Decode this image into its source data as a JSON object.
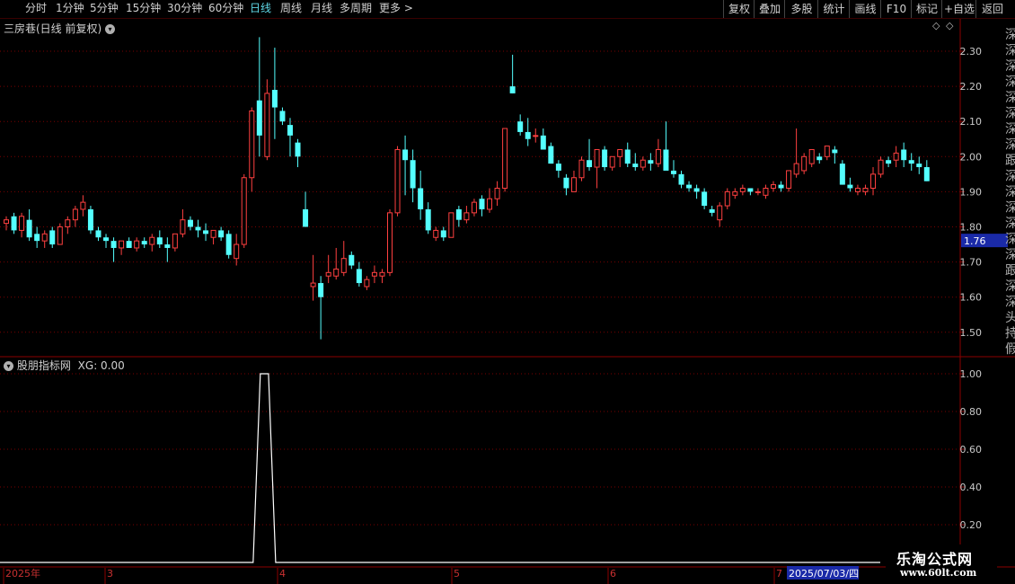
{
  "toolbar": {
    "periods": [
      "分时",
      "1分钟",
      "5分钟",
      "15分钟",
      "30分钟",
      "60分钟",
      "日线",
      "周线",
      "月线",
      "多周期",
      "更多"
    ],
    "active_period": "日线",
    "right_buttons": [
      "复权",
      "叠加",
      "多股",
      "统计",
      "画线",
      "F10",
      "标记",
      "+自选",
      "返回"
    ]
  },
  "price_panel": {
    "title": "三房巷(日线 前复权)",
    "current_price_label": "1.76",
    "y_ticks": [
      "2.30",
      "2.20",
      "2.10",
      "2.00",
      "1.90",
      "1.80",
      "1.70",
      "1.60",
      "1.50"
    ],
    "diamond_icon": "◇",
    "menu_icon": "◇"
  },
  "indicator_panel": {
    "title": "股朋指标网",
    "series_label": "XG: 0.00",
    "y_ticks": [
      "1.00",
      "0.80",
      "0.60",
      "0.40",
      "0.20"
    ]
  },
  "time_axis": {
    "labels": [
      "2025年",
      "3",
      "4",
      "5",
      "6",
      "7"
    ],
    "cursor_date": "2025/07/03/四"
  },
  "watermark": {
    "line1": "乐淘公式网",
    "line2": "www.60lt.com"
  },
  "right_strip_chars": "深深深深深深深深跟深深深深深深跟深深头持假",
  "colors": {
    "up": "#ff4040",
    "down": "#54ffff",
    "axis": "#8b0000",
    "grid": "#7a0000",
    "accent": "#5fd7e6",
    "badge": "#1a2aa8"
  },
  "chart_data": [
    {
      "type": "candlestick",
      "title": "三房巷(日线 前复权)",
      "ylim": [
        1.45,
        2.35
      ],
      "y_ticks": [
        2.3,
        2.2,
        2.1,
        2.0,
        1.9,
        1.8,
        1.7,
        1.6,
        1.5
      ],
      "ohlc": [
        [
          1.81,
          1.83,
          1.79,
          1.82
        ],
        [
          1.83,
          1.84,
          1.78,
          1.79
        ],
        [
          1.79,
          1.84,
          1.77,
          1.83
        ],
        [
          1.82,
          1.85,
          1.76,
          1.77
        ],
        [
          1.78,
          1.8,
          1.74,
          1.76
        ],
        [
          1.76,
          1.79,
          1.74,
          1.78
        ],
        [
          1.79,
          1.8,
          1.74,
          1.75
        ],
        [
          1.75,
          1.81,
          1.75,
          1.8
        ],
        [
          1.8,
          1.83,
          1.78,
          1.82
        ],
        [
          1.82,
          1.86,
          1.8,
          1.85
        ],
        [
          1.85,
          1.89,
          1.83,
          1.87
        ],
        [
          1.85,
          1.86,
          1.78,
          1.79
        ],
        [
          1.79,
          1.8,
          1.76,
          1.77
        ],
        [
          1.77,
          1.78,
          1.74,
          1.76
        ],
        [
          1.76,
          1.77,
          1.7,
          1.74
        ],
        [
          1.74,
          1.76,
          1.72,
          1.76
        ],
        [
          1.76,
          1.77,
          1.74,
          1.74
        ],
        [
          1.74,
          1.77,
          1.73,
          1.76
        ],
        [
          1.76,
          1.77,
          1.74,
          1.75
        ],
        [
          1.75,
          1.78,
          1.73,
          1.77
        ],
        [
          1.77,
          1.79,
          1.74,
          1.75
        ],
        [
          1.75,
          1.77,
          1.7,
          1.74
        ],
        [
          1.74,
          1.78,
          1.73,
          1.78
        ],
        [
          1.78,
          1.85,
          1.77,
          1.82
        ],
        [
          1.82,
          1.83,
          1.79,
          1.8
        ],
        [
          1.8,
          1.82,
          1.77,
          1.79
        ],
        [
          1.79,
          1.81,
          1.76,
          1.78
        ],
        [
          1.77,
          1.79,
          1.75,
          1.79
        ],
        [
          1.79,
          1.8,
          1.76,
          1.77
        ],
        [
          1.78,
          1.79,
          1.71,
          1.72
        ],
        [
          1.71,
          1.78,
          1.69,
          1.75
        ],
        [
          1.75,
          1.95,
          1.74,
          1.94
        ],
        [
          1.94,
          2.14,
          1.9,
          2.13
        ],
        [
          2.16,
          2.34,
          2.0,
          2.06
        ],
        [
          2.0,
          2.22,
          1.99,
          2.18
        ],
        [
          2.19,
          2.31,
          2.05,
          2.14
        ],
        [
          2.13,
          2.14,
          2.09,
          2.1
        ],
        [
          2.09,
          2.11,
          2.0,
          2.06
        ],
        [
          2.04,
          2.05,
          1.97,
          2.0
        ],
        [
          1.85,
          1.9,
          1.8,
          1.8
        ],
        [
          1.63,
          1.72,
          1.59,
          1.64
        ],
        [
          1.64,
          1.66,
          1.48,
          1.6
        ],
        [
          1.66,
          1.72,
          1.64,
          1.67
        ],
        [
          1.66,
          1.74,
          1.65,
          1.68
        ],
        [
          1.67,
          1.76,
          1.66,
          1.71
        ],
        [
          1.72,
          1.73,
          1.68,
          1.69
        ],
        [
          1.68,
          1.7,
          1.63,
          1.64
        ],
        [
          1.63,
          1.66,
          1.62,
          1.65
        ],
        [
          1.66,
          1.69,
          1.64,
          1.67
        ],
        [
          1.66,
          1.68,
          1.64,
          1.67
        ],
        [
          1.67,
          1.85,
          1.66,
          1.84
        ],
        [
          1.84,
          2.03,
          1.83,
          2.02
        ],
        [
          2.02,
          2.06,
          1.89,
          1.99
        ],
        [
          1.99,
          2.02,
          1.87,
          1.91
        ],
        [
          1.91,
          1.96,
          1.82,
          1.85
        ],
        [
          1.85,
          1.87,
          1.78,
          1.79
        ],
        [
          1.77,
          1.8,
          1.76,
          1.79
        ],
        [
          1.79,
          1.8,
          1.76,
          1.77
        ],
        [
          1.77,
          1.84,
          1.77,
          1.84
        ],
        [
          1.85,
          1.86,
          1.8,
          1.82
        ],
        [
          1.82,
          1.86,
          1.81,
          1.84
        ],
        [
          1.84,
          1.88,
          1.83,
          1.87
        ],
        [
          1.88,
          1.89,
          1.83,
          1.85
        ],
        [
          1.85,
          1.91,
          1.84,
          1.88
        ],
        [
          1.88,
          1.93,
          1.86,
          1.91
        ],
        [
          1.91,
          2.08,
          1.9,
          2.08
        ],
        [
          2.2,
          2.29,
          2.18,
          2.18
        ],
        [
          2.1,
          2.12,
          2.06,
          2.07
        ],
        [
          2.07,
          2.11,
          2.03,
          2.05
        ],
        [
          2.06,
          2.08,
          2.04,
          2.06
        ],
        [
          2.06,
          2.08,
          2.02,
          2.02
        ],
        [
          2.03,
          2.04,
          1.98,
          1.98
        ],
        [
          1.98,
          1.99,
          1.94,
          1.96
        ],
        [
          1.94,
          1.95,
          1.89,
          1.91
        ],
        [
          1.9,
          1.96,
          1.9,
          1.94
        ],
        [
          1.94,
          2.0,
          1.93,
          1.99
        ],
        [
          1.99,
          2.05,
          1.96,
          1.97
        ],
        [
          1.97,
          2.02,
          1.91,
          2.02
        ],
        [
          2.02,
          2.03,
          1.96,
          1.97
        ],
        [
          1.97,
          2.0,
          1.96,
          2.0
        ],
        [
          2.0,
          2.02,
          1.97,
          2.02
        ],
        [
          2.02,
          2.04,
          1.97,
          1.98
        ],
        [
          1.98,
          2.01,
          1.96,
          1.97
        ],
        [
          1.97,
          2.0,
          1.96,
          1.99
        ],
        [
          1.99,
          2.01,
          1.96,
          1.98
        ],
        [
          1.98,
          2.05,
          1.97,
          2.02
        ],
        [
          2.02,
          2.1,
          1.97,
          1.96
        ],
        [
          1.96,
          1.99,
          1.94,
          1.95
        ],
        [
          1.95,
          1.96,
          1.91,
          1.92
        ],
        [
          1.92,
          1.93,
          1.9,
          1.91
        ],
        [
          1.91,
          1.92,
          1.88,
          1.9
        ],
        [
          1.9,
          1.91,
          1.85,
          1.86
        ],
        [
          1.85,
          1.86,
          1.83,
          1.84
        ],
        [
          1.82,
          1.87,
          1.8,
          1.86
        ],
        [
          1.86,
          1.91,
          1.85,
          1.9
        ],
        [
          1.89,
          1.91,
          1.88,
          1.9
        ],
        [
          1.9,
          1.92,
          1.89,
          1.91
        ],
        [
          1.91,
          1.91,
          1.89,
          1.9
        ],
        [
          1.9,
          1.91,
          1.89,
          1.9
        ],
        [
          1.89,
          1.92,
          1.88,
          1.91
        ],
        [
          1.91,
          1.93,
          1.9,
          1.92
        ],
        [
          1.92,
          1.93,
          1.9,
          1.91
        ],
        [
          1.91,
          1.96,
          1.9,
          1.96
        ],
        [
          1.95,
          2.08,
          1.94,
          1.98
        ],
        [
          1.96,
          2.01,
          1.95,
          2.0
        ],
        [
          1.98,
          2.02,
          1.97,
          2.02
        ],
        [
          2.0,
          2.01,
          1.98,
          1.99
        ],
        [
          2.0,
          2.03,
          1.99,
          2.03
        ],
        [
          2.02,
          2.03,
          1.98,
          2.01
        ],
        [
          1.98,
          1.99,
          1.92,
          1.92
        ],
        [
          1.92,
          1.94,
          1.9,
          1.91
        ],
        [
          1.9,
          1.92,
          1.89,
          1.91
        ],
        [
          1.9,
          1.92,
          1.89,
          1.91
        ],
        [
          1.91,
          1.97,
          1.89,
          1.95
        ],
        [
          1.95,
          2.0,
          1.94,
          1.99
        ],
        [
          1.99,
          2.0,
          1.97,
          1.98
        ],
        [
          1.99,
          2.03,
          1.97,
          2.01
        ],
        [
          2.02,
          2.04,
          1.97,
          1.99
        ],
        [
          1.99,
          2.01,
          1.96,
          1.98
        ],
        [
          1.98,
          2.0,
          1.95,
          1.97
        ],
        [
          1.97,
          1.99,
          1.93,
          1.93
        ]
      ]
    },
    {
      "type": "line",
      "title": "股朋指标网",
      "series": [
        {
          "name": "XG",
          "spike_start_index": 33,
          "spike_end_index": 35,
          "base": 0,
          "peak": 1
        }
      ],
      "ylim": [
        0,
        1.05
      ],
      "y_ticks": [
        1.0,
        0.8,
        0.6,
        0.4,
        0.2
      ]
    }
  ]
}
